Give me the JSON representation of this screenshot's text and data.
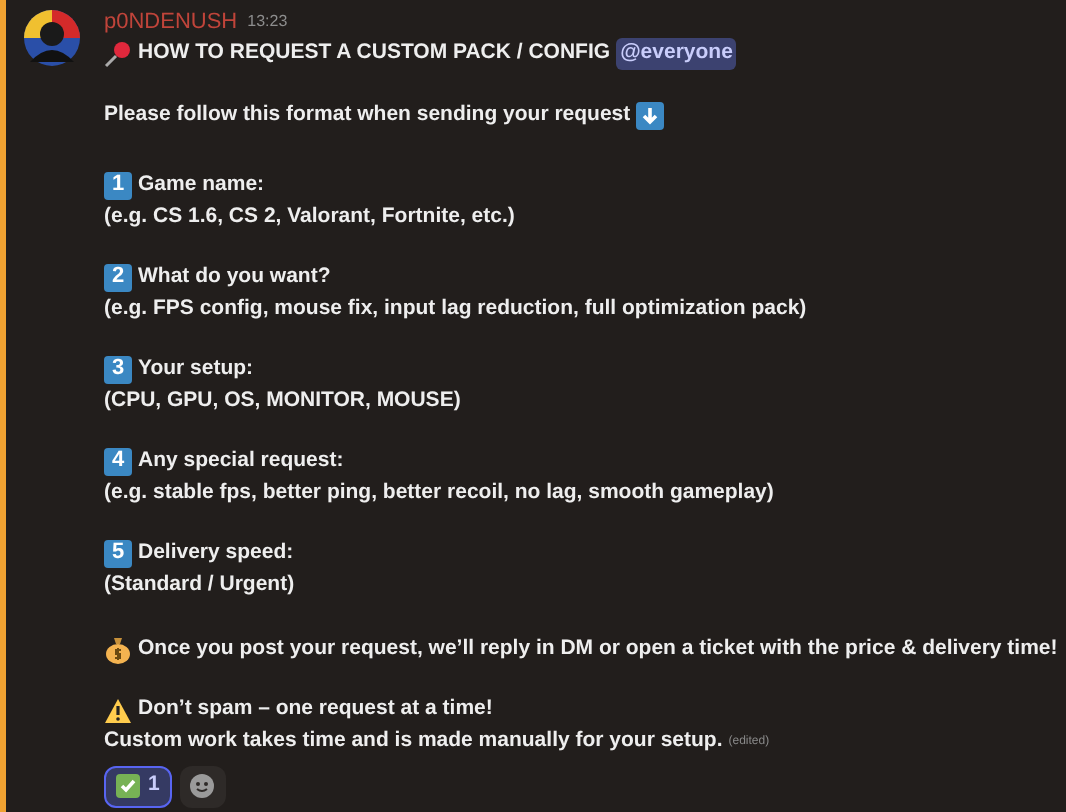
{
  "message": {
    "author": "p0NDENUSH",
    "timestamp": "13:23",
    "title": "HOW TO REQUEST A CUSTOM PACK / CONFIG",
    "mention": "@everyone",
    "intro": "Please follow this format when sending your request",
    "steps": [
      {
        "number": "1",
        "title": "Game name:",
        "detail": "(e.g. CS 1.6, CS 2, Valorant, Fortnite, etc.)"
      },
      {
        "number": "2",
        "title": "What do you want?",
        "detail": "(e.g. FPS config, mouse fix, input lag reduction, full optimization pack)"
      },
      {
        "number": "3",
        "title": "Your setup:",
        "detail": "(CPU, GPU, OS, MONITOR, MOUSE)"
      },
      {
        "number": "4",
        "title": "Any special request:",
        "detail": "(e.g. stable fps, better ping, better recoil, no lag, smooth gameplay)"
      },
      {
        "number": "5",
        "title": "Delivery speed:",
        "detail": "(Standard / Urgent)"
      }
    ],
    "notice": "Once you post your request, we’ll reply in DM or open a ticket with the price & delivery time!",
    "warning": "Don’t spam – one request at a time!",
    "note": "Custom work takes time and is made manually for your setup.",
    "edited": "(edited)",
    "reactions": [
      {
        "count": "1",
        "selected": true
      }
    ]
  }
}
